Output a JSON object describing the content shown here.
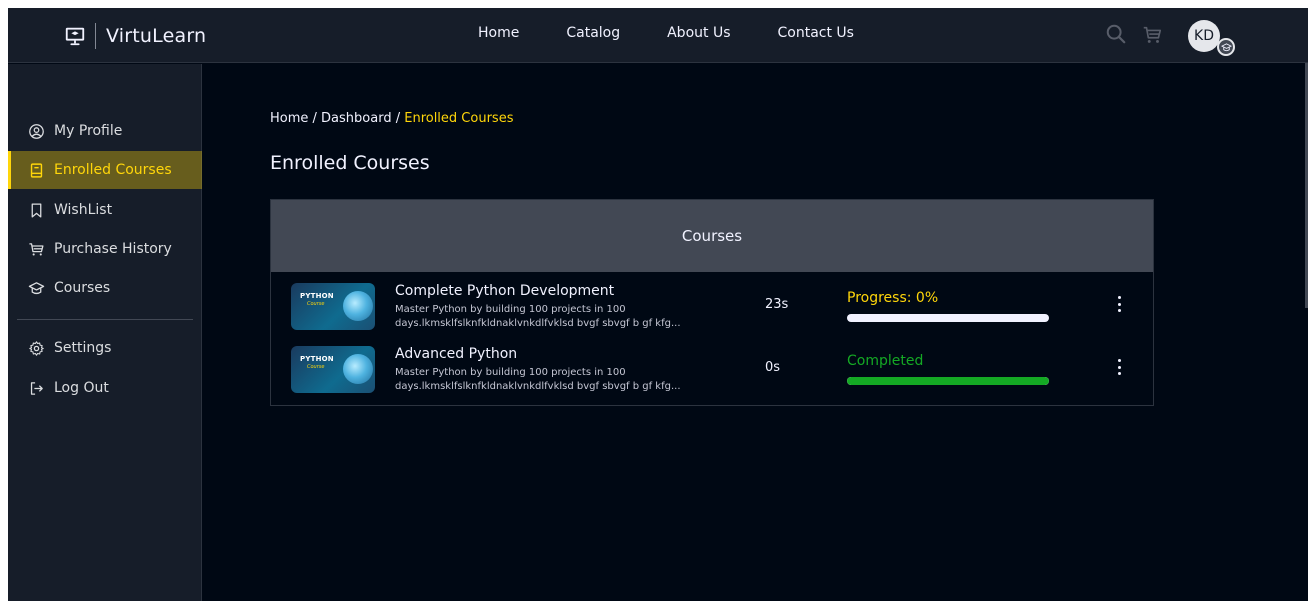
{
  "brand": {
    "name": "VirtuLearn"
  },
  "nav": {
    "links": [
      "Home",
      "Catalog",
      "About Us",
      "Contact Us"
    ],
    "avatar_initials": "KD"
  },
  "sidebar": {
    "items": [
      {
        "label": "My Profile",
        "icon": "user-circle-icon",
        "active": false
      },
      {
        "label": "Enrolled Courses",
        "icon": "book-icon",
        "active": true
      },
      {
        "label": "WishList",
        "icon": "bookmark-icon",
        "active": false
      },
      {
        "label": "Purchase History",
        "icon": "cart-icon",
        "active": false
      },
      {
        "label": "Courses",
        "icon": "graduation-cap-icon",
        "active": false
      }
    ],
    "bottom": [
      {
        "label": "Settings",
        "icon": "gear-icon"
      },
      {
        "label": "Log Out",
        "icon": "logout-icon"
      }
    ]
  },
  "breadcrumb": {
    "home": "Home",
    "sep": " / ",
    "dashboard": "Dashboard",
    "current": "Enrolled Courses"
  },
  "page": {
    "title": "Enrolled Courses"
  },
  "table": {
    "header": "Courses",
    "rows": [
      {
        "thumb_title": "PYTHON",
        "thumb_sub": "Course",
        "name": "Complete Python Development",
        "desc": "Master Python by building 100 projects in 100 days.lkmsklfslknfkldnaklvnkdlfvklsd bvgf sbvgf b gf kfg...",
        "duration": "23s",
        "progress_label": "Progress: 0%",
        "progress_percent": 0,
        "label_color": "#ffd60a"
      },
      {
        "thumb_title": "PYTHON",
        "thumb_sub": "Course",
        "name": "Advanced Python",
        "desc": "Master Python by building 100 projects in 100 days.lkmsklfslknfkldnaklvnkdlfvklsd bvgf sbvgf b gf kfg...",
        "duration": "0s",
        "progress_label": "Completed",
        "progress_percent": 100,
        "label_color": "#14a924"
      }
    ]
  },
  "colors": {
    "accent": "#ffd60a",
    "success": "#14a924",
    "background": "#000814",
    "panel": "#161d29"
  }
}
